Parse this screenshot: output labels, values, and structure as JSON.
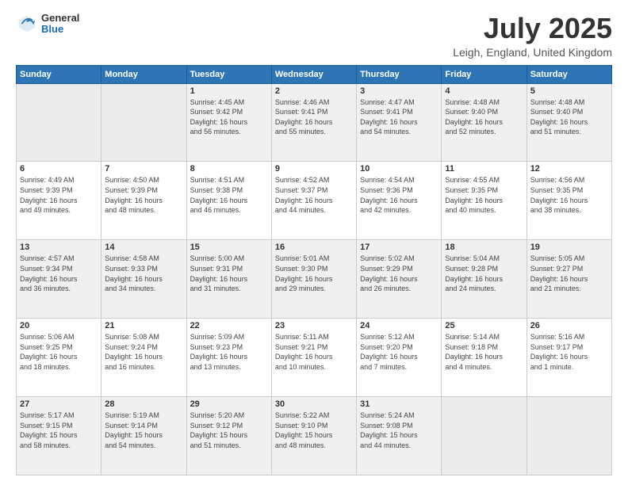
{
  "header": {
    "logo_general": "General",
    "logo_blue": "Blue",
    "main_title": "July 2025",
    "subtitle": "Leigh, England, United Kingdom"
  },
  "calendar": {
    "days_of_week": [
      "Sunday",
      "Monday",
      "Tuesday",
      "Wednesday",
      "Thursday",
      "Friday",
      "Saturday"
    ],
    "weeks": [
      [
        {
          "day": "",
          "info": ""
        },
        {
          "day": "",
          "info": ""
        },
        {
          "day": "1",
          "info": "Sunrise: 4:45 AM\nSunset: 9:42 PM\nDaylight: 16 hours\nand 56 minutes."
        },
        {
          "day": "2",
          "info": "Sunrise: 4:46 AM\nSunset: 9:41 PM\nDaylight: 16 hours\nand 55 minutes."
        },
        {
          "day": "3",
          "info": "Sunrise: 4:47 AM\nSunset: 9:41 PM\nDaylight: 16 hours\nand 54 minutes."
        },
        {
          "day": "4",
          "info": "Sunrise: 4:48 AM\nSunset: 9:40 PM\nDaylight: 16 hours\nand 52 minutes."
        },
        {
          "day": "5",
          "info": "Sunrise: 4:48 AM\nSunset: 9:40 PM\nDaylight: 16 hours\nand 51 minutes."
        }
      ],
      [
        {
          "day": "6",
          "info": "Sunrise: 4:49 AM\nSunset: 9:39 PM\nDaylight: 16 hours\nand 49 minutes."
        },
        {
          "day": "7",
          "info": "Sunrise: 4:50 AM\nSunset: 9:39 PM\nDaylight: 16 hours\nand 48 minutes."
        },
        {
          "day": "8",
          "info": "Sunrise: 4:51 AM\nSunset: 9:38 PM\nDaylight: 16 hours\nand 46 minutes."
        },
        {
          "day": "9",
          "info": "Sunrise: 4:52 AM\nSunset: 9:37 PM\nDaylight: 16 hours\nand 44 minutes."
        },
        {
          "day": "10",
          "info": "Sunrise: 4:54 AM\nSunset: 9:36 PM\nDaylight: 16 hours\nand 42 minutes."
        },
        {
          "day": "11",
          "info": "Sunrise: 4:55 AM\nSunset: 9:35 PM\nDaylight: 16 hours\nand 40 minutes."
        },
        {
          "day": "12",
          "info": "Sunrise: 4:56 AM\nSunset: 9:35 PM\nDaylight: 16 hours\nand 38 minutes."
        }
      ],
      [
        {
          "day": "13",
          "info": "Sunrise: 4:57 AM\nSunset: 9:34 PM\nDaylight: 16 hours\nand 36 minutes."
        },
        {
          "day": "14",
          "info": "Sunrise: 4:58 AM\nSunset: 9:33 PM\nDaylight: 16 hours\nand 34 minutes."
        },
        {
          "day": "15",
          "info": "Sunrise: 5:00 AM\nSunset: 9:31 PM\nDaylight: 16 hours\nand 31 minutes."
        },
        {
          "day": "16",
          "info": "Sunrise: 5:01 AM\nSunset: 9:30 PM\nDaylight: 16 hours\nand 29 minutes."
        },
        {
          "day": "17",
          "info": "Sunrise: 5:02 AM\nSunset: 9:29 PM\nDaylight: 16 hours\nand 26 minutes."
        },
        {
          "day": "18",
          "info": "Sunrise: 5:04 AM\nSunset: 9:28 PM\nDaylight: 16 hours\nand 24 minutes."
        },
        {
          "day": "19",
          "info": "Sunrise: 5:05 AM\nSunset: 9:27 PM\nDaylight: 16 hours\nand 21 minutes."
        }
      ],
      [
        {
          "day": "20",
          "info": "Sunrise: 5:06 AM\nSunset: 9:25 PM\nDaylight: 16 hours\nand 18 minutes."
        },
        {
          "day": "21",
          "info": "Sunrise: 5:08 AM\nSunset: 9:24 PM\nDaylight: 16 hours\nand 16 minutes."
        },
        {
          "day": "22",
          "info": "Sunrise: 5:09 AM\nSunset: 9:23 PM\nDaylight: 16 hours\nand 13 minutes."
        },
        {
          "day": "23",
          "info": "Sunrise: 5:11 AM\nSunset: 9:21 PM\nDaylight: 16 hours\nand 10 minutes."
        },
        {
          "day": "24",
          "info": "Sunrise: 5:12 AM\nSunset: 9:20 PM\nDaylight: 16 hours\nand 7 minutes."
        },
        {
          "day": "25",
          "info": "Sunrise: 5:14 AM\nSunset: 9:18 PM\nDaylight: 16 hours\nand 4 minutes."
        },
        {
          "day": "26",
          "info": "Sunrise: 5:16 AM\nSunset: 9:17 PM\nDaylight: 16 hours\nand 1 minute."
        }
      ],
      [
        {
          "day": "27",
          "info": "Sunrise: 5:17 AM\nSunset: 9:15 PM\nDaylight: 15 hours\nand 58 minutes."
        },
        {
          "day": "28",
          "info": "Sunrise: 5:19 AM\nSunset: 9:14 PM\nDaylight: 15 hours\nand 54 minutes."
        },
        {
          "day": "29",
          "info": "Sunrise: 5:20 AM\nSunset: 9:12 PM\nDaylight: 15 hours\nand 51 minutes."
        },
        {
          "day": "30",
          "info": "Sunrise: 5:22 AM\nSunset: 9:10 PM\nDaylight: 15 hours\nand 48 minutes."
        },
        {
          "day": "31",
          "info": "Sunrise: 5:24 AM\nSunset: 9:08 PM\nDaylight: 15 hours\nand 44 minutes."
        },
        {
          "day": "",
          "info": ""
        },
        {
          "day": "",
          "info": ""
        }
      ]
    ]
  }
}
